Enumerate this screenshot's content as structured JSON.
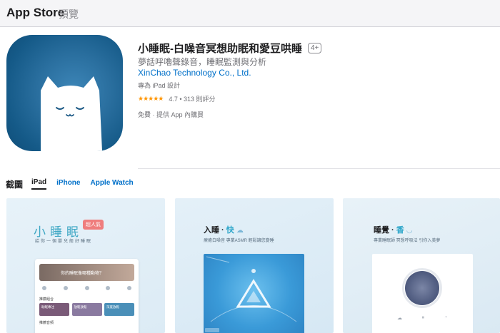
{
  "topbar": {
    "brand": "App Store",
    "preview": "預覽"
  },
  "app": {
    "title": "小睡眠-白噪音冥想助眠和愛豆哄睡",
    "age_rating": "4+",
    "subtitle": "夢話呼嚕聲錄音，睡眠監測與分析",
    "developer": "XinChao Technology Co., Ltd.",
    "designed_for": "專為 iPad 設計",
    "rating": {
      "stars": "★★★★★",
      "stars_value": 4.7,
      "text": "4.7 • 313 則評分"
    },
    "price": "免費 · 提供 App 內購買"
  },
  "screenshots": {
    "title": "截圖",
    "tabs": [
      {
        "label": "iPad",
        "active": true
      },
      {
        "label": "iPhone",
        "active": false
      },
      {
        "label": "Apple Watch",
        "active": false
      }
    ],
    "shot1": {
      "title": "小睡眠",
      "badge": "超人氣",
      "caption": "給你一個嬰兒般好睡眠",
      "banner": "你的睡眠像哪種動物？",
      "section1": "推薦組合",
      "cards": [
        "助眠專注",
        "放鬆放鬆",
        "深度放鬆"
      ],
      "section2": "推薦音頻"
    },
    "shot2": {
      "title_prefix": "入睡 · ",
      "title_accent": "快",
      "caption": "療癒白噪音 專業ASMR 輕鬆讓您變睡"
    },
    "shot3": {
      "title_prefix": "睡覺 · ",
      "title_accent": "香",
      "caption": "專業睡眠師 冥想呼吸法 引你入美夢"
    }
  },
  "colors": {
    "link": "#0070c9",
    "star": "#ff9500",
    "icon_bg": "#1a5f8f",
    "accent_teal": "#2aa5c9"
  }
}
